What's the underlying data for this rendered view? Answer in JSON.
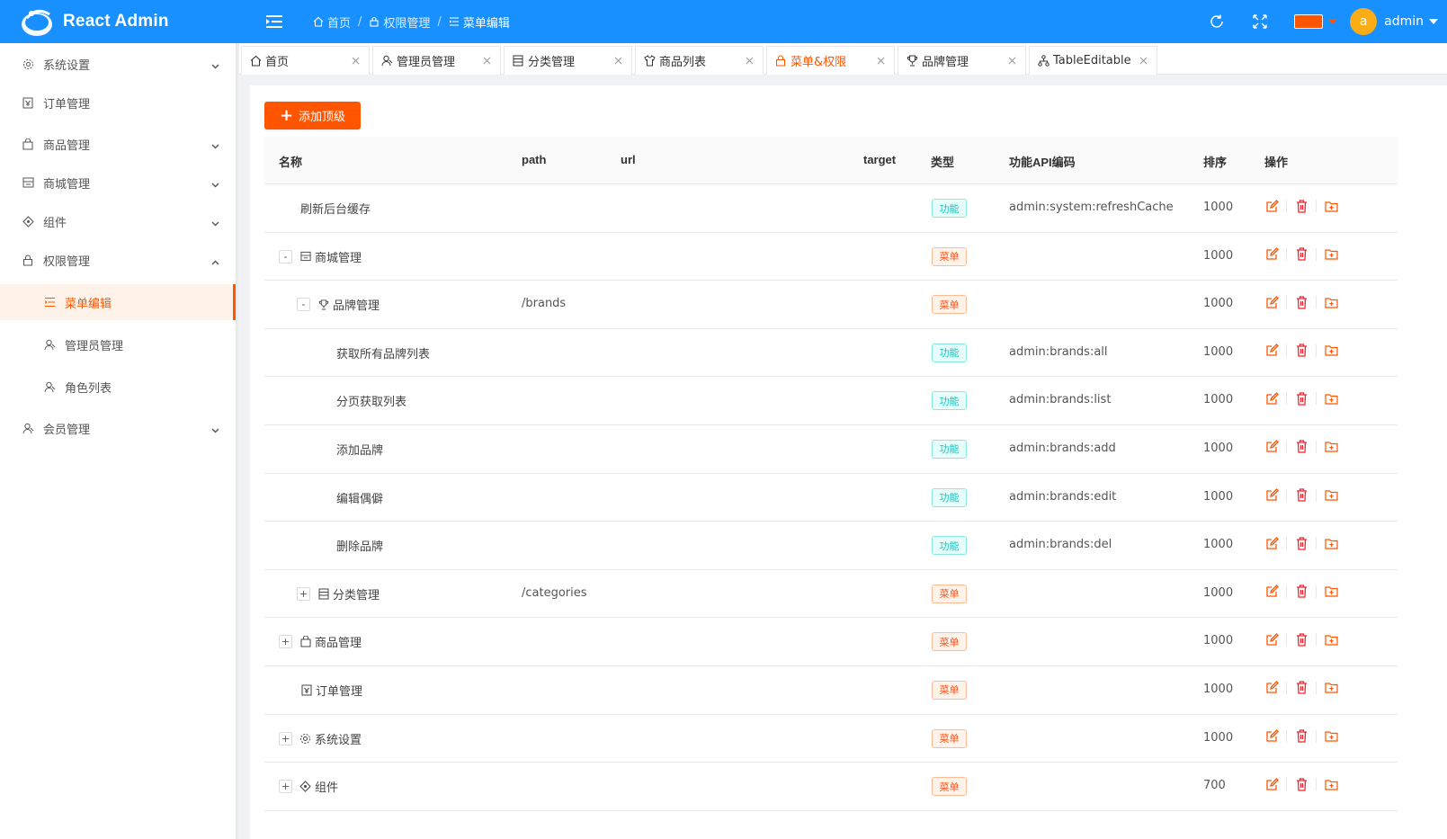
{
  "app": {
    "title": "React Admin"
  },
  "header": {
    "breadcrumb": [
      "首页",
      "权限管理",
      "菜单编辑"
    ],
    "username": "admin",
    "avatar_letter": "a",
    "theme_color": "#ff5500"
  },
  "sidebar": {
    "items": [
      {
        "label": "系统设置",
        "icon": "gear-icon",
        "expandable": true
      },
      {
        "label": "订单管理",
        "icon": "order-icon",
        "expandable": false
      },
      {
        "label": "商品管理",
        "icon": "bag-icon",
        "expandable": true
      },
      {
        "label": "商城管理",
        "icon": "shop-icon",
        "expandable": true
      },
      {
        "label": "组件",
        "icon": "component-icon",
        "expandable": true
      },
      {
        "label": "权限管理",
        "icon": "lock-icon",
        "expandable": true,
        "expanded": true
      },
      {
        "label": "菜单编辑",
        "icon": "menu-list-icon",
        "active": true,
        "child": true
      },
      {
        "label": "管理员管理",
        "icon": "user-icon",
        "child": true
      },
      {
        "label": "角色列表",
        "icon": "user-icon",
        "child": true
      },
      {
        "label": "会员管理",
        "icon": "user-icon",
        "expandable": true
      }
    ]
  },
  "tabs": [
    {
      "label": "首页",
      "icon": "home-icon"
    },
    {
      "label": "管理员管理",
      "icon": "user-icon"
    },
    {
      "label": "分类管理",
      "icon": "list-icon"
    },
    {
      "label": "商品列表",
      "icon": "shirt-icon"
    },
    {
      "label": "菜单&权限",
      "icon": "lock-icon",
      "active": true
    },
    {
      "label": "品牌管理",
      "icon": "trophy-icon"
    },
    {
      "label": "TableEditable",
      "icon": "cluster-icon"
    }
  ],
  "toolbar": {
    "add_label": "添加顶级"
  },
  "table": {
    "columns": [
      "名称",
      "path",
      "url",
      "target",
      "类型",
      "功能API编码",
      "排序",
      "操作"
    ],
    "rows": [
      {
        "name": "刷新后台缓存",
        "level": 0,
        "expander": "",
        "icon": "",
        "path": "",
        "type": "功能",
        "type_kind": "func",
        "api": "admin:system:refreshCache",
        "order": "1000"
      },
      {
        "name": "商城管理",
        "level": 0,
        "expander": "-",
        "icon": "shop-icon",
        "path": "",
        "type": "菜单",
        "type_kind": "menu",
        "api": "",
        "order": "1000"
      },
      {
        "name": "品牌管理",
        "level": 1,
        "expander": "-",
        "icon": "trophy-icon",
        "path": "/brands",
        "type": "菜单",
        "type_kind": "menu",
        "api": "",
        "order": "1000"
      },
      {
        "name": "获取所有品牌列表",
        "level": 2,
        "expander": "",
        "icon": "",
        "path": "",
        "type": "功能",
        "type_kind": "func",
        "api": "admin:brands:all",
        "order": "1000"
      },
      {
        "name": "分页获取列表",
        "level": 2,
        "expander": "",
        "icon": "",
        "path": "",
        "type": "功能",
        "type_kind": "func",
        "api": "admin:brands:list",
        "order": "1000"
      },
      {
        "name": "添加品牌",
        "level": 2,
        "expander": "",
        "icon": "",
        "path": "",
        "type": "功能",
        "type_kind": "func",
        "api": "admin:brands:add",
        "order": "1000"
      },
      {
        "name": "编辑偶僻",
        "level": 2,
        "expander": "",
        "icon": "",
        "path": "",
        "type": "功能",
        "type_kind": "func",
        "api": "admin:brands:edit",
        "order": "1000"
      },
      {
        "name": "删除品牌",
        "level": 2,
        "expander": "",
        "icon": "",
        "path": "",
        "type": "功能",
        "type_kind": "func",
        "api": "admin:brands:del",
        "order": "1000"
      },
      {
        "name": "分类管理",
        "level": 1,
        "expander": "+",
        "icon": "list-icon",
        "path": "/categories",
        "type": "菜单",
        "type_kind": "menu",
        "api": "",
        "order": "1000"
      },
      {
        "name": "商品管理",
        "level": 0,
        "expander": "+",
        "icon": "bag-icon",
        "path": "",
        "type": "菜单",
        "type_kind": "menu",
        "api": "",
        "order": "1000"
      },
      {
        "name": "订单管理",
        "level": 0,
        "expander": "",
        "icon": "order-icon",
        "path": "",
        "type": "菜单",
        "type_kind": "menu",
        "api": "",
        "order": "1000"
      },
      {
        "name": "系统设置",
        "level": 0,
        "expander": "+",
        "icon": "gear-icon",
        "path": "",
        "type": "菜单",
        "type_kind": "menu",
        "api": "",
        "order": "1000"
      },
      {
        "name": "组件",
        "level": 0,
        "expander": "+",
        "icon": "component-icon",
        "path": "",
        "type": "菜单",
        "type_kind": "menu",
        "api": "",
        "order": "700"
      }
    ]
  },
  "colors": {
    "primary": "#1890ff",
    "accent": "#ff5500",
    "func_tag": "#13c2c2",
    "menu_tag": "#fa541c",
    "delete": "#f5222d"
  }
}
